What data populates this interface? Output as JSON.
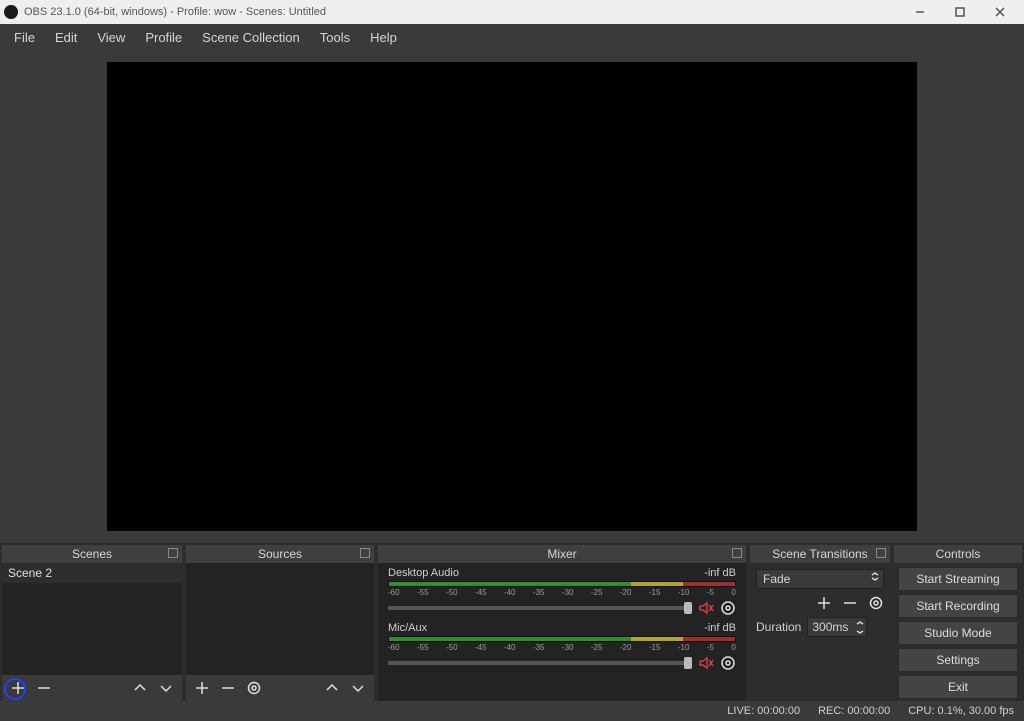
{
  "titlebar": {
    "title": "OBS 23.1.0 (64-bit, windows) - Profile: wow - Scenes: Untitled"
  },
  "menu": {
    "file": "File",
    "edit": "Edit",
    "view": "View",
    "profile": "Profile",
    "scene_collection": "Scene Collection",
    "tools": "Tools",
    "help": "Help"
  },
  "docks": {
    "scenes": {
      "title": "Scenes",
      "item0": "Scene 2"
    },
    "sources": {
      "title": "Sources"
    },
    "mixer": {
      "title": "Mixer",
      "ch0": {
        "name": "Desktop Audio",
        "level": "-inf dB"
      },
      "ch1": {
        "name": "Mic/Aux",
        "level": "-inf dB"
      },
      "ticks": {
        "t0": "-60",
        "t1": "-55",
        "t2": "-50",
        "t3": "-45",
        "t4": "-40",
        "t5": "-35",
        "t6": "-30",
        "t7": "-25",
        "t8": "-20",
        "t9": "-15",
        "t10": "-10",
        "t11": "-5",
        "t12": "0"
      }
    },
    "transitions": {
      "title": "Scene Transitions",
      "selected": "Fade",
      "duration_label": "Duration",
      "duration": "300ms"
    },
    "controls": {
      "title": "Controls",
      "start_streaming": "Start Streaming",
      "start_recording": "Start Recording",
      "studio_mode": "Studio Mode",
      "settings": "Settings",
      "exit": "Exit"
    }
  },
  "status": {
    "live": "LIVE: 00:00:00",
    "rec": "REC: 00:00:00",
    "cpu": "CPU: 0.1%, 30.00 fps"
  }
}
